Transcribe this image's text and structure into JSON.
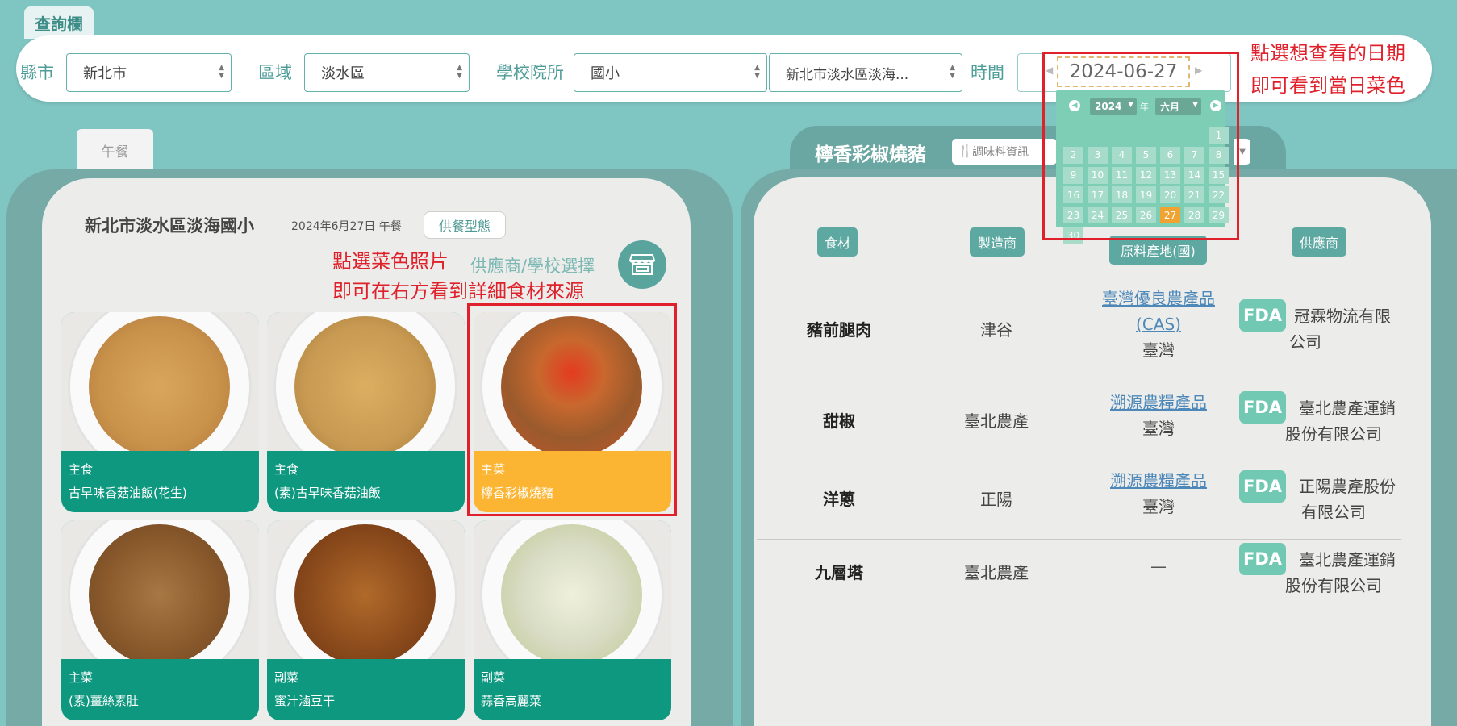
{
  "query": {
    "tab_label": "查詢欄",
    "county_label": "縣市",
    "county_value": "新北市",
    "district_label": "區域",
    "district_value": "淡水區",
    "school_type_label": "學校院所",
    "school_type_value": "國小",
    "school_value": "新北市淡水區淡海...",
    "time_label": "時間",
    "date_value": "2024-06-27"
  },
  "annotations": {
    "date_line1": "點選想查看的日期",
    "date_line2": "即可看到當日菜色",
    "photo_line1": "點選菜色照片",
    "photo_line2": "即可在右方看到詳細食材來源"
  },
  "calendar": {
    "year_value": "2024",
    "year_suffix": "年",
    "month_value": "六月",
    "selected_day": "27",
    "days": [
      "1",
      "2",
      "3",
      "4",
      "5",
      "6",
      "7",
      "8",
      "9",
      "10",
      "11",
      "12",
      "13",
      "14",
      "15",
      "16",
      "17",
      "18",
      "19",
      "20",
      "21",
      "22",
      "23",
      "24",
      "25",
      "26",
      "27",
      "28",
      "29",
      "30"
    ]
  },
  "left_panel": {
    "meal_tab": "午餐",
    "school_name": "新北市淡水區淡海國小",
    "date_meal": "2024年6月27日 午餐",
    "supply_type_button": "供餐型態",
    "supplier_select_label": "供應商/學校選擇",
    "dishes": [
      {
        "type": "主食",
        "name": "古早味香菇油飯(花生)",
        "color": "#c9924a"
      },
      {
        "type": "主食",
        "name": "(素)古早味香菇油飯",
        "color": "#c89a52"
      },
      {
        "type": "主菜",
        "name": "檸香彩椒燒豬",
        "color": "#b7592e"
      },
      {
        "type": "主菜",
        "name": "(素)薑絲素肚",
        "color": "#8a5a2c"
      },
      {
        "type": "副菜",
        "name": "蜜汁滷豆干",
        "color": "#8c4b1c"
      },
      {
        "type": "副菜",
        "name": "蒜香高麗菜",
        "color": "#d9dcc4"
      }
    ]
  },
  "right_panel": {
    "dish_title": "檸香彩椒燒豬",
    "seasoning_button": "調味料資訊",
    "headers": [
      "食材",
      "製造商",
      "原料產地(國)",
      "供應商"
    ],
    "rows": [
      {
        "ingredient": "豬前腿肉",
        "manufacturer": "津谷",
        "cert": "臺灣優良農產品(CAS)",
        "origin": "臺灣",
        "fda": "FDA",
        "supplier": "冠霖物流有限公司"
      },
      {
        "ingredient": "甜椒",
        "manufacturer": "臺北農產",
        "cert": "溯源農糧產品",
        "origin": "臺灣",
        "fda": "FDA",
        "supplier": "臺北農產運銷股份有限公司"
      },
      {
        "ingredient": "洋蔥",
        "manufacturer": "正陽",
        "cert": "溯源農糧產品",
        "origin": "臺灣",
        "fda": "FDA",
        "supplier": "正陽農產股份有限公司"
      },
      {
        "ingredient": "九層塔",
        "manufacturer": "臺北農產",
        "cert": "",
        "origin": "—",
        "fda": "FDA",
        "supplier": "臺北農產運銷股份有限公司"
      }
    ]
  },
  "colors": {
    "background": "#7fc5c2",
    "accent": "#0f9880",
    "selected": "#fcb533",
    "annotation_red": "#e0202a"
  }
}
